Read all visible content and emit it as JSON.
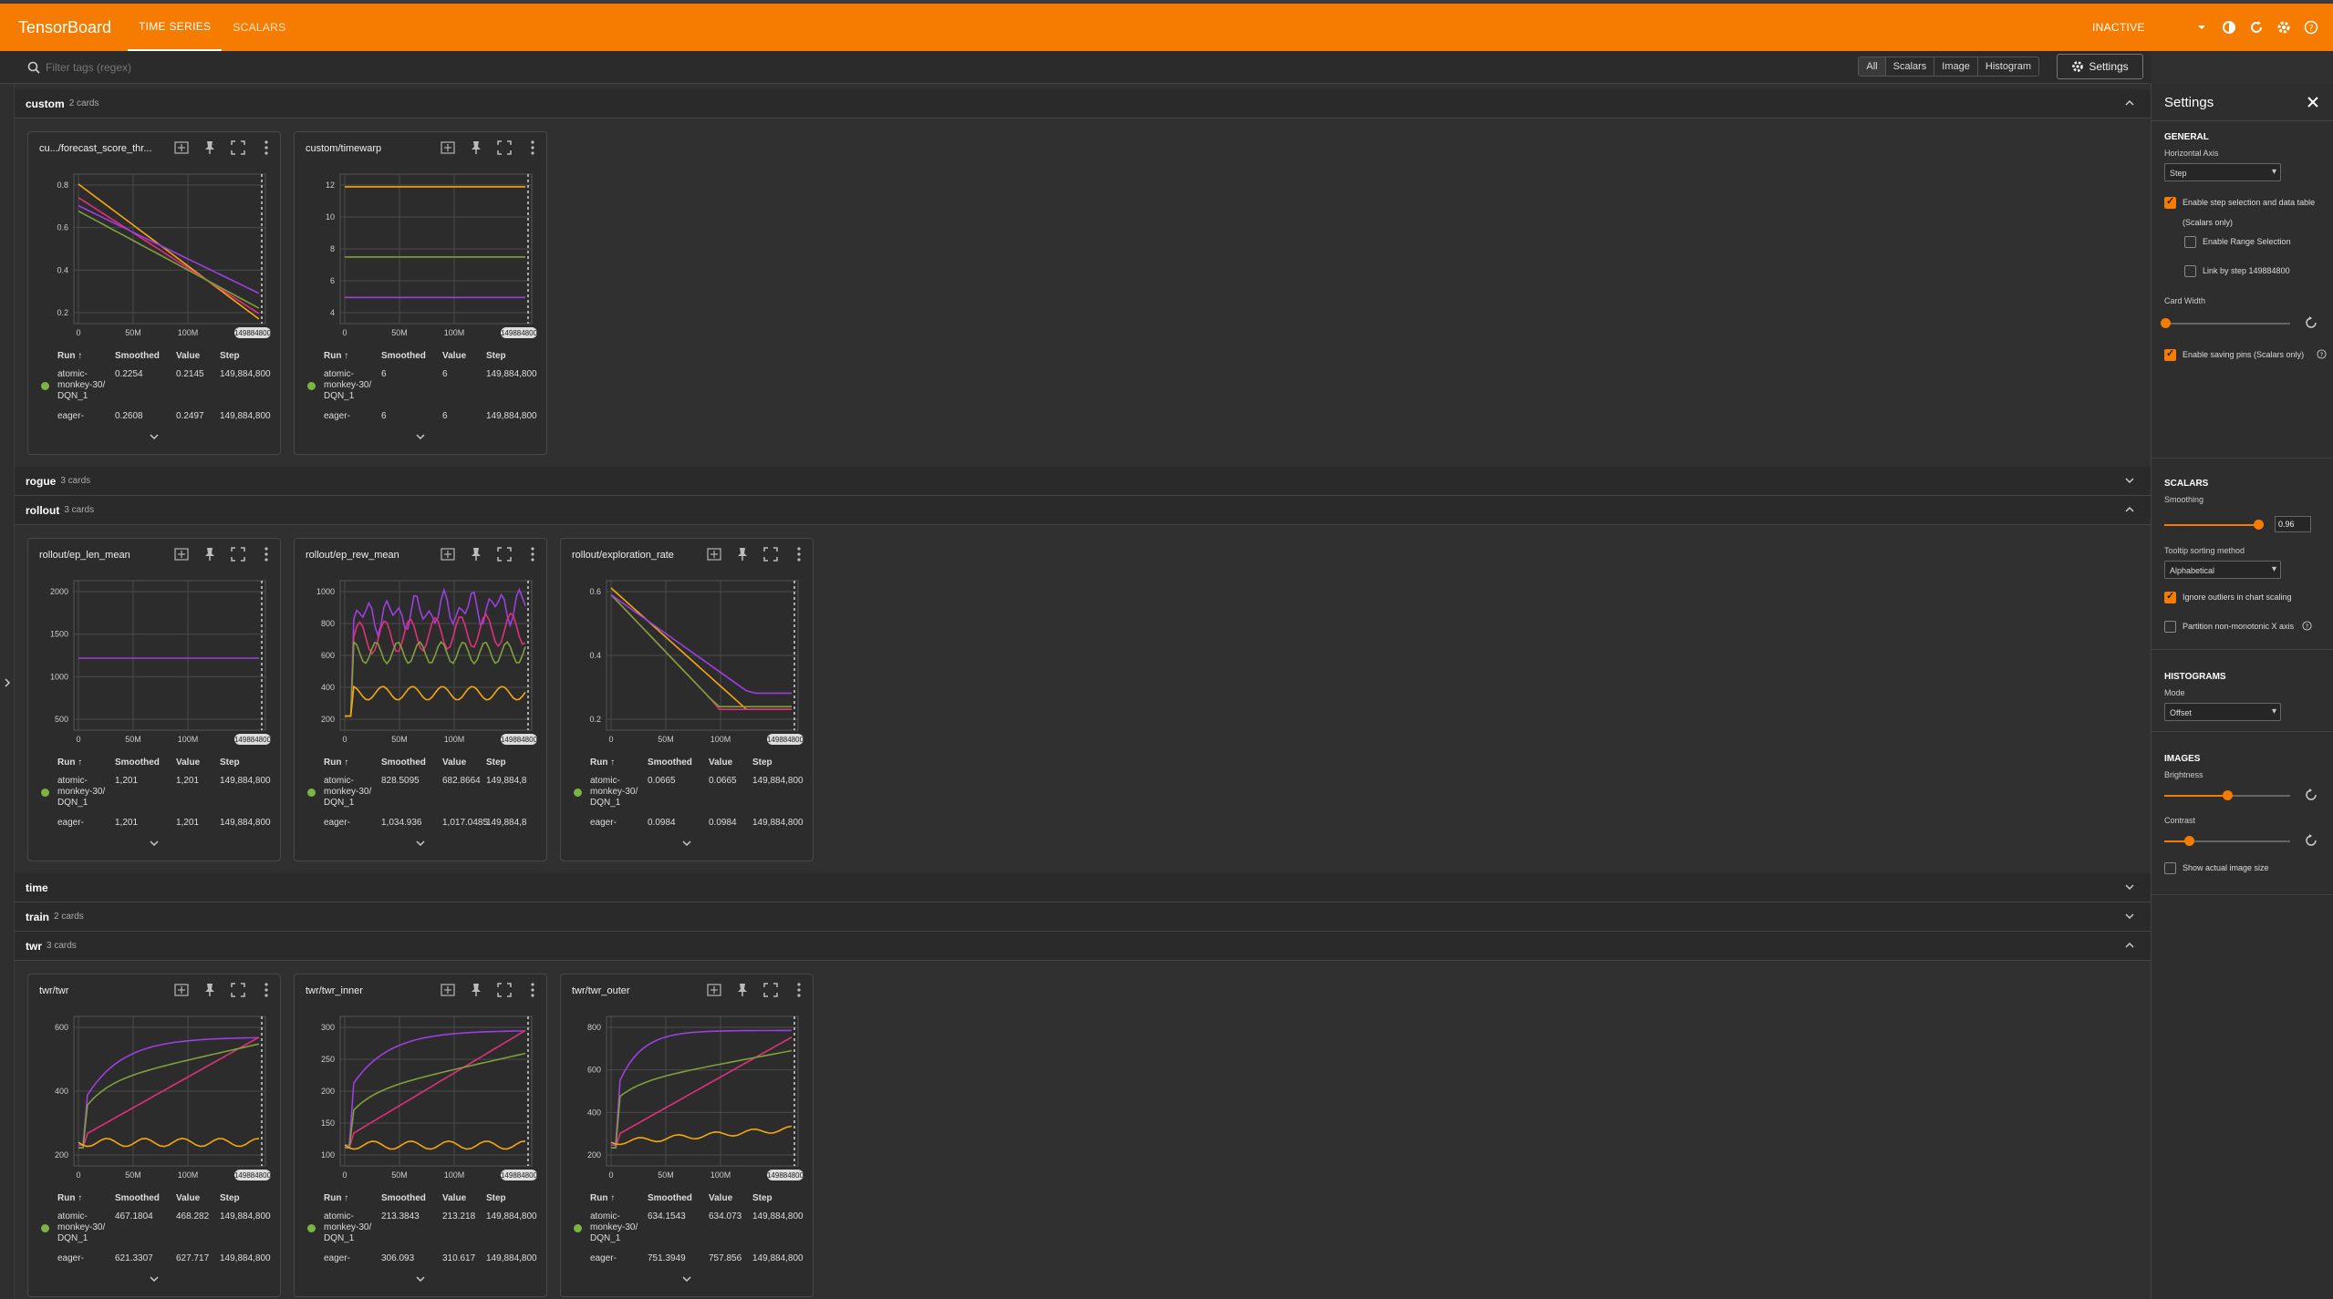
{
  "header": {
    "brand": "TensorBoard",
    "tabs": [
      {
        "label": "TIME SERIES"
      },
      {
        "label": "SCALARS"
      }
    ],
    "status": "INACTIVE"
  },
  "filter": {
    "placeholder": "Filter tags (regex)",
    "types": [
      "All",
      "Scalars",
      "Image",
      "Histogram"
    ],
    "settings_label": "Settings"
  },
  "colors": {
    "accent": "#f57c00",
    "run_dot": "#7cb342",
    "line_orange": "#f5a70f",
    "line_purple": "#9c3fe0",
    "line_magenta": "#e0307a",
    "line_green": "#7fa03a"
  },
  "table_header": {
    "run": "Run ↑",
    "smoothed": "Smoothed",
    "value": "Value",
    "step": "Step"
  },
  "step_badge": "149884800",
  "groups": [
    {
      "name": "custom",
      "count": "2 cards",
      "expanded": true
    },
    {
      "name": "rogue",
      "count": "3 cards",
      "expanded": false
    },
    {
      "name": "rollout",
      "count": "3 cards",
      "expanded": true
    },
    {
      "name": "time",
      "count": "",
      "expanded": false
    },
    {
      "name": "train",
      "count": "2 cards",
      "expanded": false
    },
    {
      "name": "twr",
      "count": "3 cards",
      "expanded": true
    }
  ],
  "cards": [
    {
      "title": "cu.../forecast_score_thr...",
      "yticks": [
        "0.8",
        "0.6",
        "0.4",
        "0.2"
      ],
      "xticks": [
        "0",
        "50M",
        "100M"
      ],
      "rows": [
        {
          "run": [
            "atomic-",
            "monkey-30/",
            "DQN_1"
          ],
          "smoothed": "0.2254",
          "value": "0.2145",
          "step": "149,884,800"
        },
        {
          "run": [
            "eager-"
          ],
          "smoothed": "0.2608",
          "value": "0.2497",
          "step": "149,884,800"
        }
      ]
    },
    {
      "title": "custom/timewarp",
      "yticks": [
        "12",
        "10",
        "8",
        "6",
        "4"
      ],
      "xticks": [
        "0",
        "50M",
        "100M"
      ],
      "rows": [
        {
          "run": [
            "atomic-",
            "monkey-30/",
            "DQN_1"
          ],
          "smoothed": "6",
          "value": "6",
          "step": "149,884,800"
        },
        {
          "run": [
            "eager-"
          ],
          "smoothed": "6",
          "value": "6",
          "step": "149,884,800"
        }
      ]
    },
    {
      "title": "rollout/ep_len_mean",
      "yticks": [
        "2000",
        "1500",
        "1000",
        "500"
      ],
      "xticks": [
        "0",
        "50M",
        "100M"
      ],
      "rows": [
        {
          "run": [
            "atomic-",
            "monkey-30/",
            "DQN_1"
          ],
          "smoothed": "1,201",
          "value": "1,201",
          "step": "149,884,800"
        },
        {
          "run": [
            "eager-"
          ],
          "smoothed": "1,201",
          "value": "1,201",
          "step": "149,884,800"
        }
      ]
    },
    {
      "title": "rollout/ep_rew_mean",
      "yticks": [
        "1000",
        "800",
        "600",
        "400",
        "200"
      ],
      "xticks": [
        "0",
        "50M",
        "100M"
      ],
      "rows": [
        {
          "run": [
            "atomic-",
            "monkey-30/",
            "DQN_1"
          ],
          "smoothed": "828.5095",
          "value": "682.8664",
          "step": "149,884,8"
        },
        {
          "run": [
            "eager-"
          ],
          "smoothed": "1,034.936",
          "value": "1,017.0485",
          "step": "149,884,8"
        }
      ]
    },
    {
      "title": "rollout/exploration_rate",
      "yticks": [
        "0.6",
        "0.4",
        "0.2"
      ],
      "xticks": [
        "0",
        "50M",
        "100M"
      ],
      "rows": [
        {
          "run": [
            "atomic-",
            "monkey-30/",
            "DQN_1"
          ],
          "smoothed": "0.0665",
          "value": "0.0665",
          "step": "149,884,800"
        },
        {
          "run": [
            "eager-"
          ],
          "smoothed": "0.0984",
          "value": "0.0984",
          "step": "149,884,800"
        }
      ]
    },
    {
      "title": "twr/twr",
      "yticks": [
        "600",
        "400",
        "200"
      ],
      "xticks": [
        "0",
        "50M",
        "100M"
      ],
      "rows": [
        {
          "run": [
            "atomic-",
            "monkey-30/",
            "DQN_1"
          ],
          "smoothed": "467.1804",
          "value": "468.282",
          "step": "149,884,800"
        },
        {
          "run": [
            "eager-"
          ],
          "smoothed": "621.3307",
          "value": "627.717",
          "step": "149,884,800"
        }
      ]
    },
    {
      "title": "twr/twr_inner",
      "yticks": [
        "300",
        "250",
        "200",
        "150",
        "100"
      ],
      "xticks": [
        "0",
        "50M",
        "100M"
      ],
      "rows": [
        {
          "run": [
            "atomic-",
            "monkey-30/",
            "DQN_1"
          ],
          "smoothed": "213.3843",
          "value": "213.218",
          "step": "149,884,800"
        },
        {
          "run": [
            "eager-"
          ],
          "smoothed": "306.093",
          "value": "310.617",
          "step": "149,884,800"
        }
      ]
    },
    {
      "title": "twr/twr_outer",
      "yticks": [
        "800",
        "600",
        "400",
        "200"
      ],
      "xticks": [
        "0",
        "50M",
        "100M"
      ],
      "rows": [
        {
          "run": [
            "atomic-",
            "monkey-30/",
            "DQN_1"
          ],
          "smoothed": "634.1543",
          "value": "634.073",
          "step": "149,884,800"
        },
        {
          "run": [
            "eager-"
          ],
          "smoothed": "751.3949",
          "value": "757.856",
          "step": "149,884,800"
        }
      ]
    }
  ],
  "settings": {
    "title": "Settings",
    "general": "GENERAL",
    "horizontal_axis": "Horizontal Axis",
    "horizontal_axis_value": "Step",
    "enable_step": "Enable step selection and data table",
    "scalars_only": "(Scalars only)",
    "enable_range": "Enable Range Selection",
    "link_step": "Link by step 149884800",
    "card_width": "Card Width",
    "enable_pins": "Enable saving pins (Scalars only)",
    "scalars": "SCALARS",
    "smoothing": "Smoothing",
    "smoothing_value": "0.96",
    "tooltip_sort": "Tooltip sorting method",
    "tooltip_sort_value": "Alphabetical",
    "ignore_outliers": "Ignore outliers in chart scaling",
    "partition": "Partition non-monotonic X axis",
    "histograms": "HISTOGRAMS",
    "mode": "Mode",
    "mode_value": "Offset",
    "images": "IMAGES",
    "brightness": "Brightness",
    "contrast": "Contrast",
    "show_actual": "Show actual image size"
  }
}
